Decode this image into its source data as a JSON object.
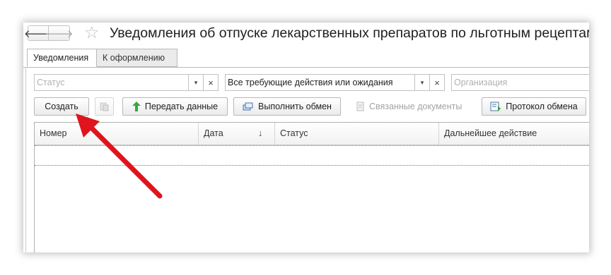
{
  "window": {
    "title": "Уведомления об отпуске лекарственных препаратов по льготным рецептам",
    "nav_back": "🡐",
    "nav_forward": "🡒",
    "favorite_icon": "star-icon"
  },
  "tabs": [
    {
      "label": "Уведомления",
      "active": true
    },
    {
      "label": "К оформлению",
      "active": false
    }
  ],
  "filters": {
    "status": {
      "value": "",
      "placeholder": "Статус"
    },
    "actions": {
      "value": "Все требующие действия или ожидания"
    },
    "organization": {
      "value": "",
      "placeholder": "Организация"
    },
    "dropdown_glyph": "▾",
    "clear_glyph": "×"
  },
  "toolbar": {
    "create_label": "Создать",
    "transfer_label": "Передать данные",
    "exchange_label": "Выполнить обмен",
    "related_docs_label": "Связанные документы",
    "protocol_label": "Протокол обмена"
  },
  "table": {
    "columns": [
      "Номер",
      "Дата",
      "Статус",
      "Дальнейшее действие"
    ],
    "sort_indicator": "↓",
    "rows": []
  },
  "colors": {
    "arrow_annotation": "#e0141e",
    "transfer_icon": "#3aa53a"
  }
}
